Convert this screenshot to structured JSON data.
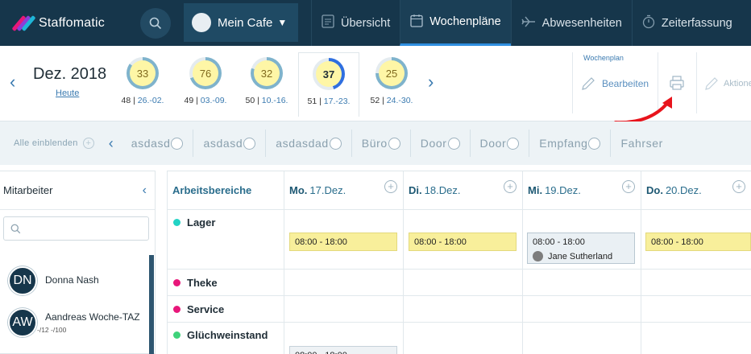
{
  "app": {
    "name": "Staffomatic"
  },
  "nav": {
    "location": "Mein Cafe",
    "items": [
      {
        "label": "Übersicht",
        "icon": "overview-icon",
        "active": false
      },
      {
        "label": "Wochenpläne",
        "icon": "calendar-icon",
        "active": true
      },
      {
        "label": "Abwesenheiten",
        "icon": "plane-icon",
        "active": false
      },
      {
        "label": "Zeiterfassung",
        "icon": "stopwatch-icon",
        "active": false
      }
    ]
  },
  "weekbar": {
    "month": "Dez. 2018",
    "today": "Heute",
    "weeks": [
      {
        "count": "33",
        "num": "48",
        "range": "26.-02.",
        "fill": 0.85
      },
      {
        "count": "76",
        "num": "49",
        "range": "03.-09.",
        "fill": 0.7
      },
      {
        "count": "32",
        "num": "50",
        "range": "10.-16.",
        "fill": 0.8
      },
      {
        "count": "37",
        "num": "51",
        "range": "17.-23.",
        "fill": 0.45,
        "selected": true
      },
      {
        "count": "25",
        "num": "52",
        "range": "24.-30.",
        "fill": 0.75
      }
    ],
    "wochenplan_title": "Wochenplan",
    "edit_label": "Bearbeiten",
    "actions_label": "Aktione"
  },
  "filter": {
    "show_all": "Alle einblenden",
    "chips": [
      "asdasd",
      "asdasd",
      "asdasdad",
      "Büro",
      "Door",
      "Door",
      "Empfang",
      "Fahrser"
    ]
  },
  "employees": {
    "title": "Mitarbeiter",
    "list": [
      {
        "initials": "DN",
        "name": "Donna Nash",
        "sub": ""
      },
      {
        "initials": "AW",
        "name": "Aandreas Woche-TAZ",
        "sub": "-/12 -/100"
      }
    ]
  },
  "schedule": {
    "areas_header": "Arbeitsbereiche",
    "days": [
      {
        "abbr": "Mo.",
        "date": "17.Dez."
      },
      {
        "abbr": "Di.",
        "date": "18.Dez."
      },
      {
        "abbr": "Mi.",
        "date": "19.Dez."
      },
      {
        "abbr": "Do.",
        "date": "20.Dez."
      }
    ],
    "areas": [
      {
        "name": "Lager",
        "color": "#22d3c5"
      },
      {
        "name": "Theke",
        "color": "#e8177a"
      },
      {
        "name": "Service",
        "color": "#e8177a"
      },
      {
        "name": "Glüchweinstand",
        "color": "#3fd27a"
      }
    ],
    "shifts": {
      "lager_mo": "08:00 - 18:00",
      "lager_di": "08:00 - 18:00",
      "lager_mi": "08:00 - 18:00",
      "lager_mi_person": "Jane Sutherland",
      "lager_do": "08:00 - 18:00",
      "gluehwein_mo": "08:00 - 18:00"
    }
  },
  "colors": {
    "nav_bg": "#16364b",
    "accent": "#2f8fe0",
    "shift": "#f8ef9b",
    "arrow": "#e8141c"
  }
}
